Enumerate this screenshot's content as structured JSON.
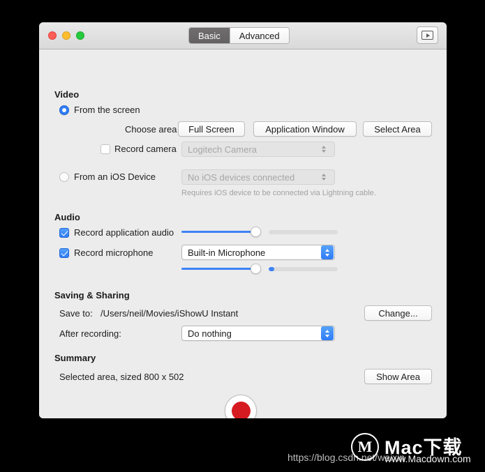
{
  "window": {
    "traffic_lights": [
      "close",
      "minimize",
      "maximize"
    ],
    "tabs": [
      {
        "label": "Basic",
        "active": true
      },
      {
        "label": "Advanced",
        "active": false
      }
    ],
    "toolbar_button_icon": "play-video-icon"
  },
  "video": {
    "section_title": "Video",
    "from_screen": {
      "label": "From the screen",
      "selected": true
    },
    "choose_area": {
      "label": "Choose area",
      "buttons": [
        "Full Screen",
        "Application Window",
        "Select Area"
      ]
    },
    "record_camera": {
      "label": "Record camera",
      "checked": false,
      "device": "Logitech Camera",
      "enabled": false
    },
    "from_ios": {
      "label": "From an iOS Device",
      "selected": false,
      "device": "No iOS devices connected",
      "hint": "Requires iOS device to be connected via Lightning cable."
    }
  },
  "audio": {
    "section_title": "Audio",
    "application_audio": {
      "label": "Record application audio",
      "checked": true,
      "volume_percent": 86,
      "meter_percent": 0
    },
    "microphone": {
      "label": "Record microphone",
      "checked": true,
      "device": "Built-in Microphone",
      "volume_percent": 86,
      "meter_percent": 8
    }
  },
  "saving": {
    "section_title": "Saving & Sharing",
    "save_to_label": "Save to:",
    "save_to_path": "/Users/neil/Movies/iShowU Instant",
    "change_button": "Change...",
    "after_recording_label": "After recording:",
    "after_recording_value": "Do nothing"
  },
  "summary": {
    "section_title": "Summary",
    "text": "Selected area, sized 800 x 502",
    "show_area_button": "Show Area"
  },
  "record": {
    "button_name": "record-button"
  },
  "watermark": {
    "url": "https://blog.csdn.net/weixin",
    "logo_letter": "M",
    "brand": "Mac下载",
    "site": "www.Macdown.com"
  },
  "colors": {
    "accent_blue": "#2f7cf6",
    "record_red": "#d61a21",
    "window_bg": "#ececec",
    "titlebar_bg": "#e2e2e2"
  }
}
